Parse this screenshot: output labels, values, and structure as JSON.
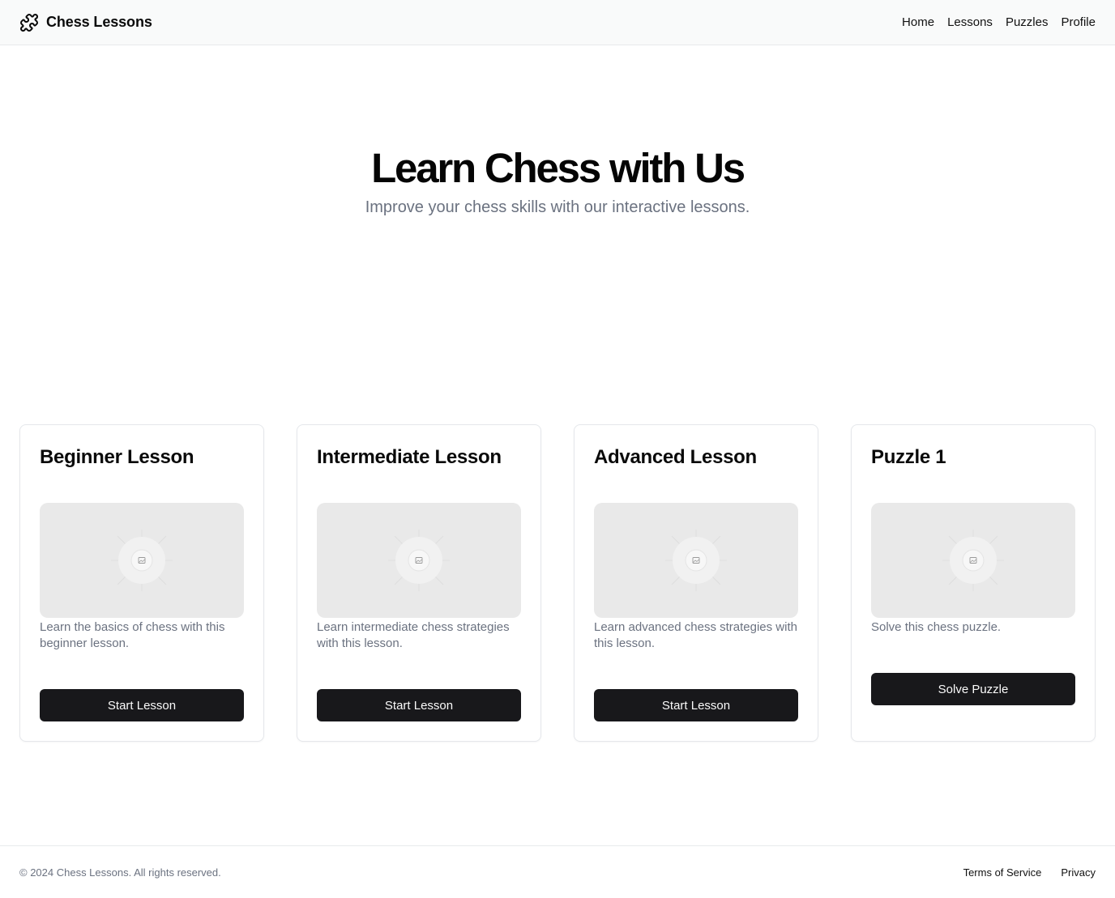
{
  "header": {
    "brand": "Chess Lessons",
    "brand_icon": "puzzle-icon",
    "nav": [
      {
        "label": "Home"
      },
      {
        "label": "Lessons"
      },
      {
        "label": "Puzzles"
      },
      {
        "label": "Profile"
      }
    ]
  },
  "hero": {
    "title": "Learn Chess with Us",
    "subtitle": "Improve your chess skills with our interactive lessons."
  },
  "cards": [
    {
      "title": "Beginner Lesson",
      "image_icon": "image-placeholder-icon",
      "description": "Learn the basics of chess with this beginner lesson.",
      "button": "Start Lesson"
    },
    {
      "title": "Intermediate Lesson",
      "image_icon": "image-placeholder-icon",
      "description": "Learn intermediate chess strategies with this lesson.",
      "button": "Start Lesson"
    },
    {
      "title": "Advanced Lesson",
      "image_icon": "image-placeholder-icon",
      "description": "Learn advanced chess strategies with this lesson.",
      "button": "Start Lesson"
    },
    {
      "title": "Puzzle 1",
      "image_icon": "image-placeholder-icon",
      "description": "Solve this chess puzzle.",
      "button": "Solve Puzzle"
    }
  ],
  "footer": {
    "copyright": "© 2024 Chess Lessons. All rights reserved.",
    "links": [
      {
        "label": "Terms of Service"
      },
      {
        "label": "Privacy"
      }
    ]
  },
  "colors": {
    "header_bg": "#f9fafa",
    "button_bg": "#18181b",
    "muted_text": "#6b7280",
    "border": "#e5e7eb",
    "placeholder_bg": "#e9e9e9"
  }
}
